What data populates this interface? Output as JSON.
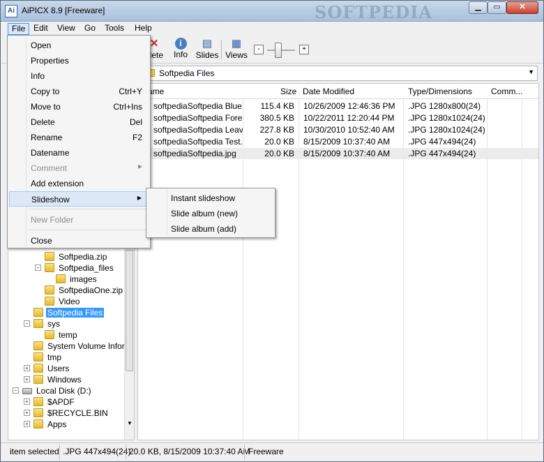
{
  "window": {
    "title": "AiPICX 8.9 [Freeware]",
    "app_icon": "Ai",
    "watermark": "SOFTPEDIA",
    "min": "▁",
    "max": "▭",
    "close": "✕"
  },
  "menubar": [
    "File",
    "Edit",
    "View",
    "Go",
    "Tools",
    "Help"
  ],
  "toolbar": {
    "delete": "elete",
    "info": "Info",
    "slides": "Slides",
    "views": "Views",
    "zoom_minus": "-",
    "zoom_plus": "+"
  },
  "address": "Softpedia Files",
  "file_list": {
    "columns": [
      "ame",
      "Size",
      "Date Modified",
      "Type/Dimensions",
      "Comm..."
    ],
    "rows": [
      {
        "name": "softpediaSoftpedia Blue.j...",
        "size": "115.4 KB",
        "date": "10/26/2009 12:46:36 PM",
        "type": ".JPG 1280x800(24)"
      },
      {
        "name": "softpediaSoftpedia Fores...",
        "size": "380.5 KB",
        "date": "10/22/2011 12:20:44 PM",
        "type": ".JPG 1280x1024(24)"
      },
      {
        "name": "softpediaSoftpedia Leav...",
        "size": "227.8 KB",
        "date": "10/30/2010 10:52:40 AM",
        "type": ".JPG 1280x1024(24)"
      },
      {
        "name": "softpediaSoftpedia Test...",
        "size": "20.0 KB",
        "date": "8/15/2009 10:37:40 AM",
        "type": ".JPG 447x494(24)"
      },
      {
        "name": "softpediaSoftpedia.jpg",
        "size": "20.0 KB",
        "date": "8/15/2009 10:37:40 AM",
        "type": ".JPG 447x494(24)"
      }
    ]
  },
  "tree": [
    {
      "label": "Softpedia.zip"
    },
    {
      "label": "Softpedia_files",
      "exp": "−"
    },
    {
      "label": "images"
    },
    {
      "label": "SoftpediaOne.zip"
    },
    {
      "label": "Video"
    },
    {
      "label": "Softpedia Files"
    },
    {
      "label": "sys",
      "exp": "−"
    },
    {
      "label": "temp"
    },
    {
      "label": "System Volume Informa"
    },
    {
      "label": "tmp"
    },
    {
      "label": "Users",
      "exp": "+"
    },
    {
      "label": "Windows",
      "exp": "+"
    },
    {
      "label": "Local Disk (D:)",
      "exp": "−"
    },
    {
      "label": "$APDF",
      "exp": "+"
    },
    {
      "label": "$RECYCLE.BIN",
      "exp": "+"
    },
    {
      "label": "Apps",
      "exp": "+"
    }
  ],
  "file_menu": [
    {
      "label": "Open"
    },
    {
      "label": "Properties"
    },
    {
      "label": "Info"
    },
    {
      "label": "Copy to",
      "shortcut": "Ctrl+Y"
    },
    {
      "label": "Move to",
      "shortcut": "Ctrl+Ins"
    },
    {
      "label": "Delete",
      "shortcut": "Del"
    },
    {
      "label": "Rename",
      "shortcut": "F2"
    },
    {
      "label": "Datename"
    },
    {
      "label": "Comment",
      "arrow": "▶"
    },
    {
      "label": "Add extension"
    },
    {
      "label": "Slideshow",
      "arrow": "▶"
    },
    {
      "label": "New Folder"
    },
    {
      "label": "Close"
    }
  ],
  "slideshow_submenu": [
    "Instant slideshow",
    "Slide album (new)",
    "Slide album (add)"
  ],
  "status": {
    "items": "item selected",
    "type": ".JPG 447x494(24)",
    "info": "20.0 KB, 8/15/2009 10:37:40 AM",
    "license": "Freeware"
  }
}
